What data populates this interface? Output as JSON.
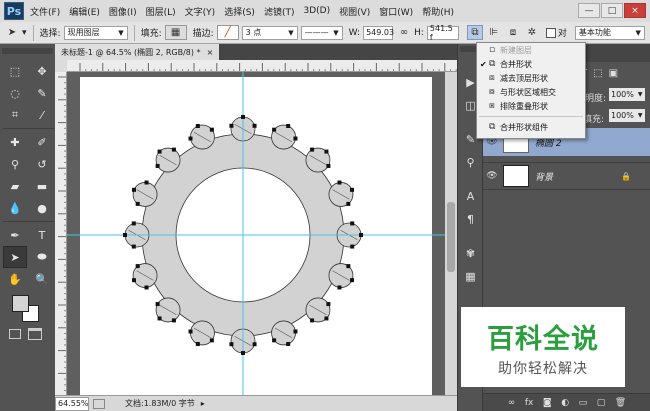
{
  "app": {
    "logo": "Ps"
  },
  "menubar": {
    "items": [
      "文件(F)",
      "编辑(E)",
      "图像(I)",
      "图层(L)",
      "文字(Y)",
      "选择(S)",
      "滤镜(T)",
      "3D(D)",
      "视图(V)",
      "窗口(W)",
      "帮助(H)"
    ],
    "window_controls": [
      "—",
      "□",
      "×"
    ]
  },
  "options_bar": {
    "select_label": "选择:",
    "select_value": "现用图层",
    "fill_label": "填充:",
    "stroke_label": "描边:",
    "stroke_width": "3 点",
    "width_label": "W:",
    "width_value": "549.03",
    "height_label": "H:",
    "height_value": "541.5 f",
    "workspace": "基本功能",
    "icons": [
      "arrow-tool-icon",
      "path-operations-icon",
      "path-alignment-icon",
      "path-arrangement-icon",
      "gear-icon",
      "link-icon"
    ]
  },
  "document": {
    "tab_title": "未标题-1 @ 64.5% (椭圆 2, RGB/8) *",
    "tab_close": "×",
    "zoom": "64.55%",
    "doc_info": "文档:1.83M/0 字节",
    "ruler_numbers": [
      "0",
      "50",
      "100",
      "150",
      "200",
      "250",
      "300",
      "350",
      "400",
      "450",
      "500",
      "550",
      "600",
      "650",
      "700"
    ]
  },
  "dropdown": {
    "items": [
      {
        "label": "新建图层",
        "checked": false,
        "disabled": true,
        "icon": "new-layer-icon"
      },
      {
        "label": "合并形状",
        "checked": true,
        "disabled": false,
        "icon": "combine-shapes-icon"
      },
      {
        "label": "减去顶层形状",
        "checked": false,
        "disabled": false,
        "icon": "subtract-front-shape-icon"
      },
      {
        "label": "与形状区域相交",
        "checked": false,
        "disabled": false,
        "icon": "intersect-shape-icon"
      },
      {
        "label": "排除重叠形状",
        "checked": false,
        "disabled": false,
        "icon": "exclude-overlap-icon"
      },
      {
        "label": "合并形状组件",
        "checked": false,
        "disabled": false,
        "icon": "merge-components-icon"
      }
    ]
  },
  "layers_panel": {
    "opacity_label": "明度:",
    "opacity_value": "100%",
    "fill_label": "填充:",
    "fill_value": "100%",
    "layers": [
      {
        "name": "椭圆 2",
        "selected": true
      },
      {
        "name": "背景",
        "selected": false,
        "locked": true
      }
    ],
    "footer_icons": [
      "link-icon",
      "fx-icon",
      "mask-icon",
      "adjustment-icon",
      "folder-icon",
      "new-layer-icon",
      "trash-icon"
    ]
  },
  "watermark": {
    "title": "百科全说",
    "subtitle": "助你轻松解决"
  },
  "colors": {
    "shape_fill": "#d2d2d2",
    "guide": "#43c5e8",
    "anchor": "#111111",
    "watermark_green": "#2a9f3e"
  }
}
